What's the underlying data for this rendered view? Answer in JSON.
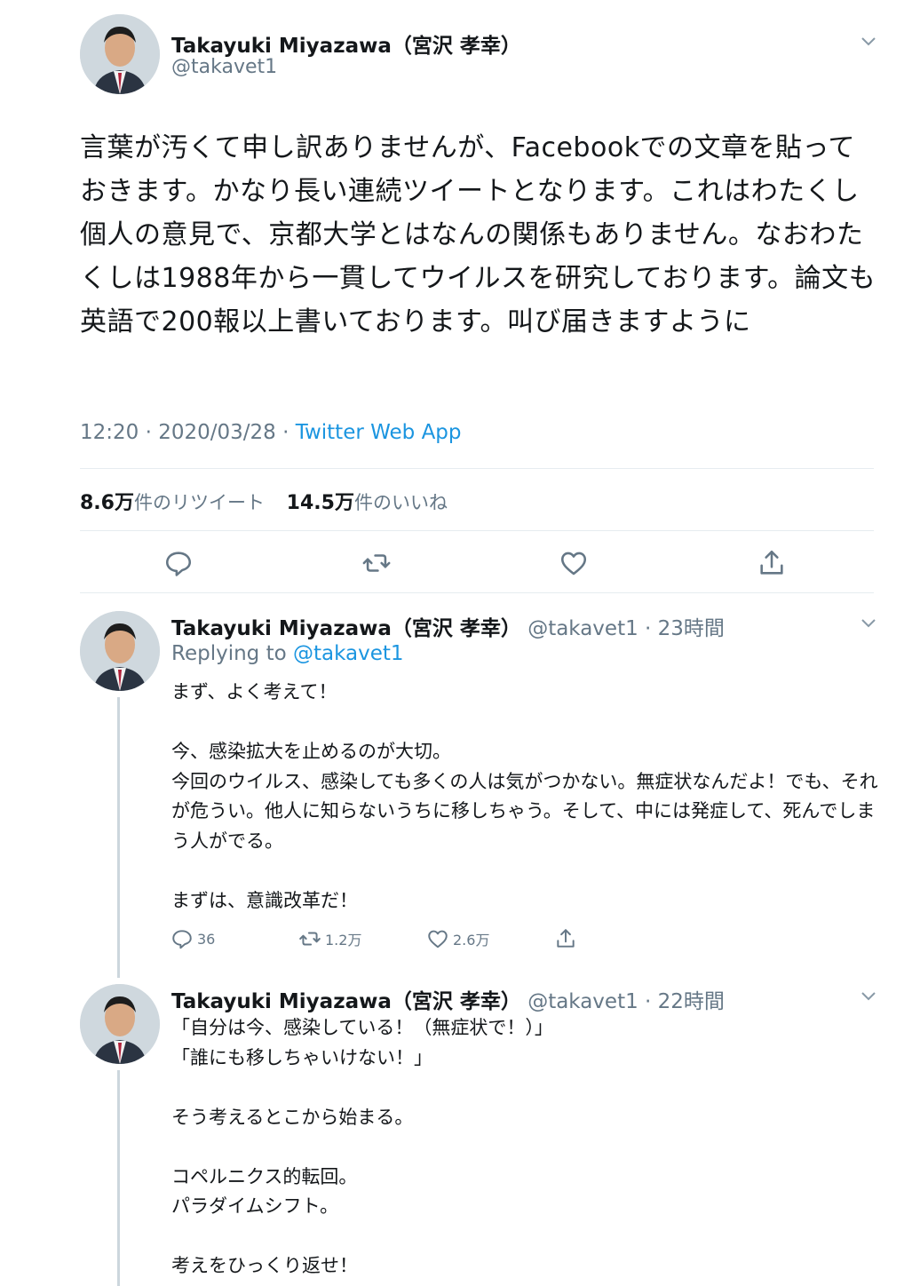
{
  "main_tweet": {
    "author_name": "Takayuki Miyazawa（宮沢 孝幸）",
    "handle": "@takavet1",
    "text": "言葉が汚くて申し訳ありませんが、Facebookでの文章を貼っておきます。かなり長い連続ツイートとなります。これはわたくし個人の意見で、京都大学とはなんの関係もありません。なおわたくしは1988年から一貫してウイルスを研究しております。論文も英語で200報以上書いております。叫び届きますように",
    "time": "12:20 · 2020/03/28 · ",
    "source": "Twitter Web App",
    "retweet_count": "8.6万",
    "retweet_label": "件のリツイート",
    "like_count": "14.5万",
    "like_label": "件のいいね"
  },
  "replies": [
    {
      "author_name": "Takayuki Miyazawa（宮沢 孝幸）",
      "handle_time": "@takavet1 · 23時間",
      "replying_prefix": "Replying to ",
      "replying_handle": "@takavet1",
      "text": "まず、よく考えて！\n\n今、感染拡大を止めるのが大切。\n今回のウイルス、感染しても多くの人は気がつかない。無症状なんだよ！でも、それが危うい。他人に知らないうちに移しちゃう。そして、中には発症して、死んでしまう人がでる。\n\nまずは、意識改革だ！",
      "reply_count": "36",
      "retweet_count": "1.2万",
      "like_count": "2.6万"
    },
    {
      "author_name": "Takayuki Miyazawa（宮沢 孝幸）",
      "handle_time": "@takavet1 · 22時間",
      "text": "「自分は今、感染している！（無症状で！）」\n「誰にも移しちゃいけない！」\n\nそう考えるとこから始まる。\n\nコペルニクス的転回。\nパラダイムシフト。\n\n考えをひっくり返せ！"
    }
  ],
  "icons": {
    "reply": "reply-icon",
    "retweet": "retweet-icon",
    "like": "heart-icon",
    "share": "share-icon",
    "menu": "chevron-down-icon"
  },
  "colors": {
    "link": "#1b95e0",
    "muted": "#657786",
    "divider": "#e6ecf0"
  }
}
